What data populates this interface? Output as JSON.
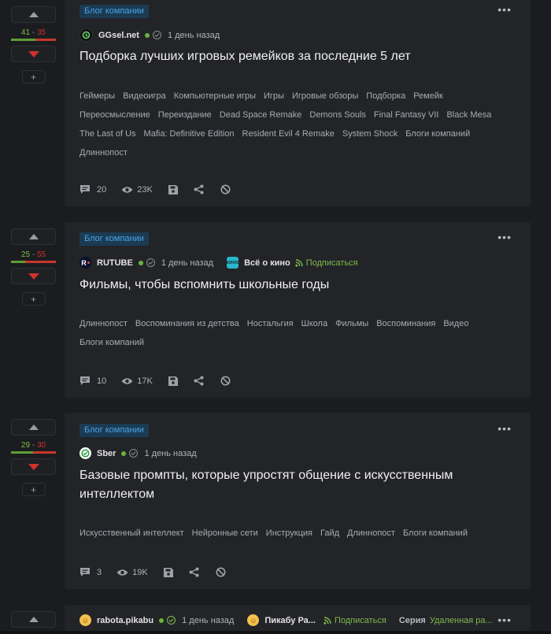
{
  "posts": [
    {
      "rating": {
        "plus": "41",
        "minus": "35",
        "plus_frac": 0.54
      },
      "badge": "Блог компании",
      "author": {
        "name": "GGsel.net",
        "time": "1 день назад",
        "avatar_color": "#1a1a1a"
      },
      "title": "Подборка лучших игровых ремейков за последние 5 лет",
      "tags": [
        "Геймеры",
        "Видеоигра",
        "Компьютерные игры",
        "Игры",
        "Игровые обзоры",
        "Подборка",
        "Ремейк",
        "Переосмысление",
        "Переиздание",
        "Dead Space Remake",
        "Demons Souls",
        "Final Fantasy VII",
        "Black Mesa",
        "The Last of Us",
        "Mafia: Definitive Edition",
        "Resident Evil 4 Remake",
        "System Shock",
        "Блоги компаний",
        "Длиннопост"
      ],
      "comments": "20",
      "views": "23K"
    },
    {
      "rating": {
        "plus": "25",
        "minus": "55",
        "plus_frac": 0.31
      },
      "badge": "Блог компании",
      "author": {
        "name": "RUTUBE",
        "time": "1 день назад",
        "avatar_color": "#0a0f2c"
      },
      "community": {
        "name": "Всё о кино",
        "subscribe": "Подписаться"
      },
      "title": "Фильмы, чтобы вспомнить школьные годы",
      "tags": [
        "Длиннопост",
        "Воспоминания из детства",
        "Ностальгия",
        "Школа",
        "Фильмы",
        "Воспоминания",
        "Видео",
        "Блоги компаний"
      ],
      "comments": "10",
      "views": "17K"
    },
    {
      "rating": {
        "plus": "29",
        "minus": "30",
        "plus_frac": 0.49
      },
      "badge": "Блог компании",
      "author": {
        "name": "Sber",
        "time": "1 день назад",
        "avatar_color": "#ffffff"
      },
      "title": "Базовые промпты, которые упростят общение с искусственным интеллектом",
      "tags": [
        "Искусственный интеллект",
        "Нейронные сети",
        "Инструкция",
        "Гайд",
        "Длиннопост",
        "Блоги компаний"
      ],
      "comments": "3",
      "views": "19K"
    }
  ],
  "partial_post": {
    "author": {
      "name": "rabota.pikabu",
      "time": "1 день назад"
    },
    "community": {
      "name": "Пикабу Ра...",
      "subscribe": "Подписаться"
    },
    "series_label": "Серия",
    "series_name": "Удаленная ра..."
  },
  "colors": {
    "accent_green": "#7dbb4a",
    "accent_red": "#d0312d",
    "badge_blue": "#4aa3e6"
  }
}
